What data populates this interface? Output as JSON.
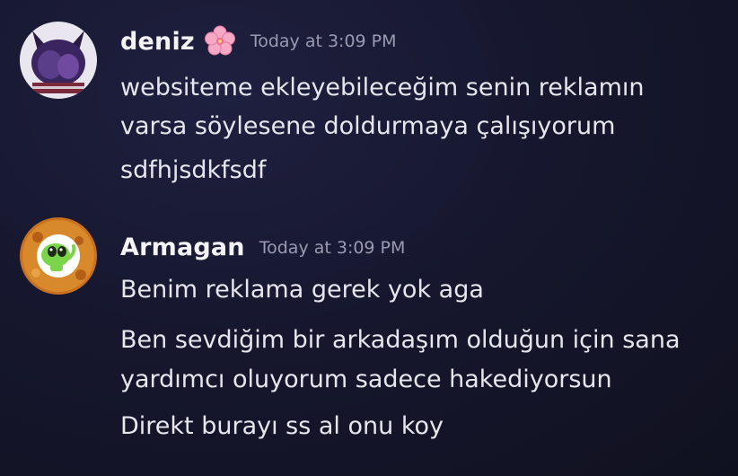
{
  "messages": [
    {
      "username": "deniz",
      "badge_icon": "cherry-blossom-icon",
      "timestamp": "Today at 3:09 PM",
      "lines": [
        "websiteme ekleyebileceğim senin reklamın",
        "varsa söylesene doldurmaya çalışıyorum",
        "sdfhjsdkfsdf"
      ]
    },
    {
      "username": "Armagan",
      "timestamp": "Today at 3:09 PM",
      "lines": [
        "Benim reklama gerek yok aga",
        "Ben sevdiğim bir arkadaşım olduğun için sana",
        "yardımcı oluyorum sadece hakediyorsun",
        "Direkt burayı ss al onu koy"
      ]
    }
  ],
  "colors": {
    "background": "#16172e",
    "username": "#f4f4f8",
    "timestamp": "#9a9bb0",
    "text": "#e6e6ee",
    "flower": "#f7a8c4"
  }
}
